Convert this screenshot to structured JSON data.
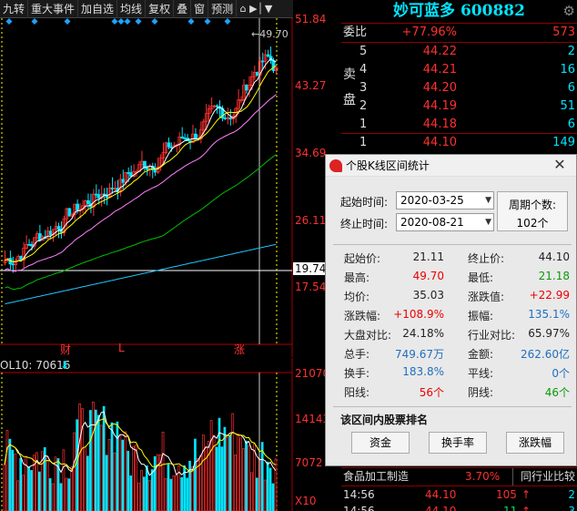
{
  "toolbar": {
    "items": [
      "九转",
      "重大事件",
      "加自选",
      "均线",
      "复权",
      "叠",
      "窗",
      "预测"
    ],
    "icons": [
      "lock-icon",
      "arrow-right-bar-icon",
      "dropdown-icon"
    ]
  },
  "main_chart": {
    "y_labels": [
      "51.84",
      "43.27",
      "34.69",
      "26.11",
      "17.54"
    ],
    "current_price_label": "19.74",
    "high_marker": "49.70",
    "x_markers": [
      "财",
      "L",
      "涨"
    ],
    "colors": {
      "up": "#ff3030",
      "down": "#00e5ff",
      "ma5": "#ffffff",
      "ma10": "#ffff00",
      "ma20": "#ff80ff",
      "ma60": "#00c000",
      "ma120": "#1ec8ff"
    }
  },
  "chart_data": {
    "type": "line",
    "x": [
      "2020-03-25",
      "2020-08-21"
    ],
    "series": [],
    "ylim": [
      17.54,
      51.84
    ],
    "y_ticks": [
      17.54,
      26.11,
      34.69,
      43.27,
      51.84
    ]
  },
  "vol_chart": {
    "title": "OL10: 70616",
    "y_labels": [
      "21070",
      "14143",
      "7072"
    ],
    "unit": "X10"
  },
  "quote": {
    "stock_name": "妙可蓝多",
    "stock_code": "600882",
    "weibi_label": "委比",
    "weibi_value": "+77.96%",
    "weibi_diff": "573",
    "sell_label": "卖盘",
    "sell": [
      {
        "n": "5",
        "price": "44.22",
        "vol": "2"
      },
      {
        "n": "4",
        "price": "44.21",
        "vol": "16"
      },
      {
        "n": "3",
        "price": "44.20",
        "vol": "6"
      },
      {
        "n": "2",
        "price": "44.19",
        "vol": "51"
      },
      {
        "n": "1",
        "price": "44.18",
        "vol": "6"
      }
    ],
    "buy1": {
      "n": "1",
      "price": "44.10",
      "vol": "149"
    },
    "industry": {
      "name": "食品加工制造",
      "pct": "3.70%",
      "btn": "同行业比较"
    },
    "ticks": [
      {
        "time": "14:56",
        "price": "44.10",
        "vol": "105",
        "arrow": "↑",
        "n": "2"
      },
      {
        "time": "14:56",
        "price": "44.10",
        "vol": "11",
        "arrow": "↑",
        "n": "3"
      }
    ]
  },
  "dialog": {
    "title": "个股K线区间统计",
    "start_label": "起始时间:",
    "start_value": "2020-03-25",
    "end_label": "终止时间:",
    "end_value": "2020-08-21",
    "period_label": "周期个数:",
    "period_value": "102个",
    "stats": [
      {
        "l": "起始价:",
        "v": "21.11",
        "c": "blk",
        "l2": "终止价:",
        "v2": "44.10",
        "c2": "blk"
      },
      {
        "l": "最高:",
        "v": "49.70",
        "c": "red",
        "l2": "最低:",
        "v2": "21.18",
        "c2": "green"
      },
      {
        "l": "均价:",
        "v": "35.03",
        "c": "blk",
        "l2": "涨跌值:",
        "v2": "+22.99",
        "c2": "red"
      },
      {
        "l": "涨跌幅:",
        "v": "+108.9%",
        "c": "red",
        "l2": "振幅:",
        "v2": "135.1%",
        "c2": "blue"
      },
      {
        "l": "大盘对比:",
        "v": "24.18%",
        "c": "blk",
        "l2": "行业对比:",
        "v2": "65.97%",
        "c2": "blk"
      },
      {
        "l": "总手:",
        "v": "749.67万",
        "c": "blue",
        "l2": "金额:",
        "v2": "262.60亿",
        "c2": "blue"
      },
      {
        "l": "换手:",
        "v": "183.8%",
        "c": "blue",
        "l2": "平线:",
        "v2": "0个",
        "c2": "blue"
      },
      {
        "l": "阳线:",
        "v": "56个",
        "c": "red",
        "l2": "阴线:",
        "v2": "46个",
        "c2": "green"
      }
    ],
    "rank_title": "该区间内股票排名",
    "buttons": [
      "资金",
      "换手率",
      "涨跌幅"
    ]
  }
}
